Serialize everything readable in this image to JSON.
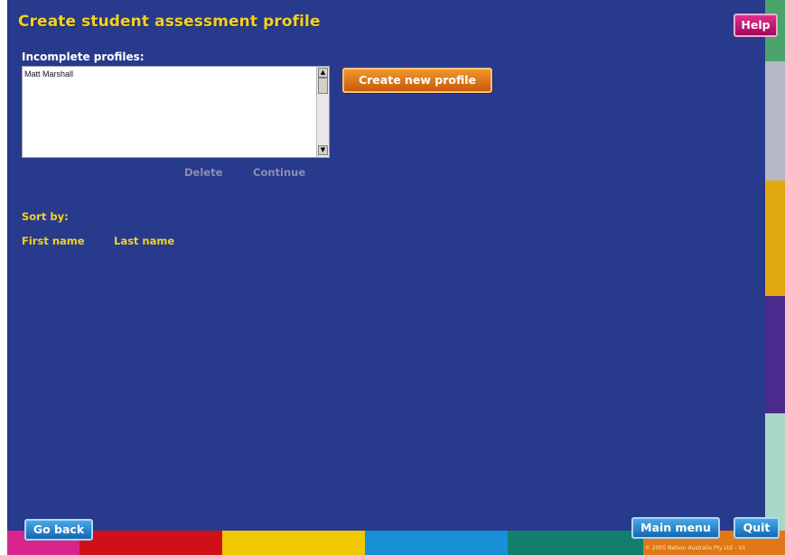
{
  "title": "Create student assessment profile",
  "help_label": "Help",
  "incomplete_label": "Incomplete profiles:",
  "profiles": [
    "Matt Marshall"
  ],
  "create_label": "Create new profile",
  "delete_label": "Delete",
  "continue_label": "Continue",
  "sort_label": "Sort by:",
  "sort_first": "First name",
  "sort_last": "Last name",
  "go_back_label": "Go back",
  "main_menu_label": "Main menu",
  "quit_label": "Quit",
  "copyright": "© 2005 Nelson Australia Pty Ltd – V1",
  "colors": {
    "background": "#283a8c",
    "accent_yellow": "#f4d21c",
    "right_bar": [
      "#4aa46c",
      "#b4b8c4",
      "#e0aa10",
      "#4a2a8c",
      "#a8d8c8"
    ],
    "bottom_bar": [
      "#d8248c",
      "#d01018",
      "#f0c800",
      "#1890d8",
      "#10806c",
      "#e07818"
    ]
  }
}
